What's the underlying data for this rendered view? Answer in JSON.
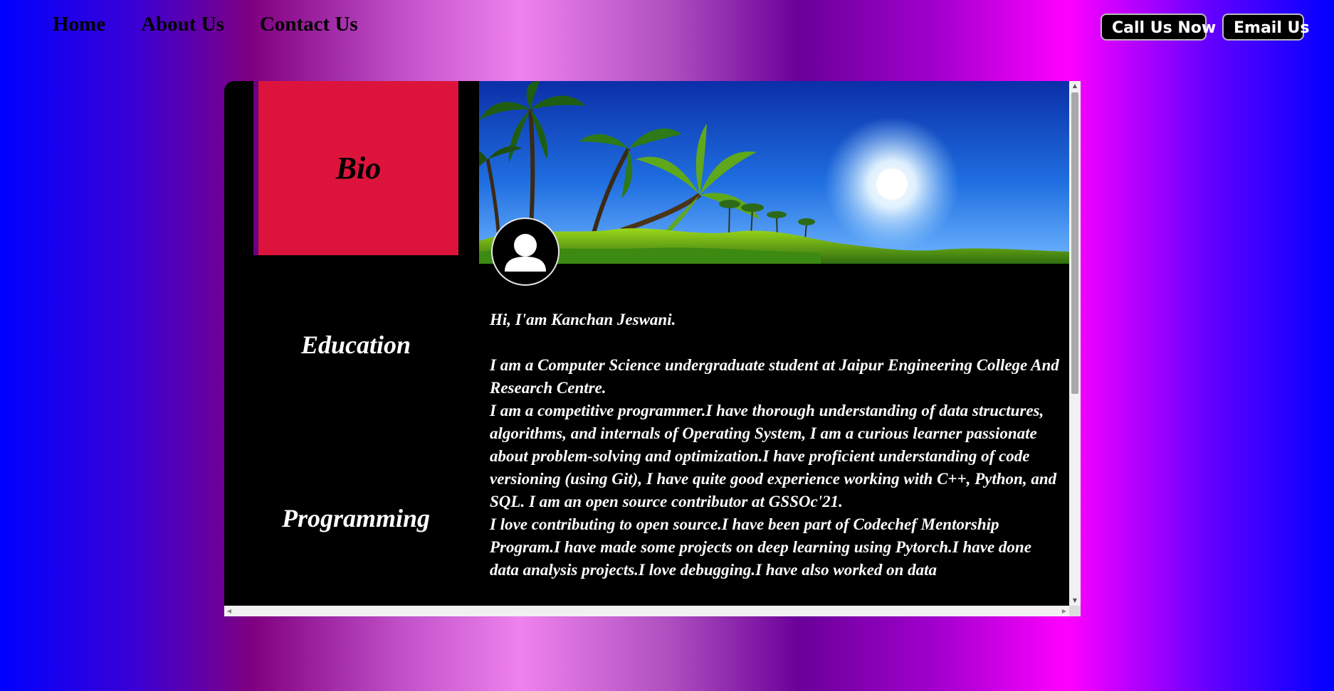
{
  "nav": {
    "home": "Home",
    "about": "About Us",
    "contact": "Contact Us"
  },
  "actions": {
    "call": "Call Us Now",
    "email": "Email Us"
  },
  "sidebar": {
    "bio": "Bio",
    "education": "Education",
    "programming": "Programming"
  },
  "profile": {
    "greeting": "Hi, I'am Kanchan Jeswani.",
    "para1": "I am a Computer Science undergraduate student at Jaipur Engineering College And Research Centre.",
    "para2": "I am a competitive programmer.I have thorough understanding of data structures, algorithms, and internals of Operating System, I am a curious learner passionate about problem-solving and optimization.I have proficient understanding of code versioning (using Git), I have quite good experience working with C++, Python, and SQL. I am an open source contributor at GSSOc'21.",
    "para3": "I love contributing to open source.I have been part of Codechef Mentorship Program.I have made some projects on deep learning using Pytorch.I have done data analysis projects.I love debugging.I have also worked on data"
  },
  "icons": {
    "avatar": "user-silhouette-icon",
    "cover": "tropical-beach-palms-image"
  },
  "colors": {
    "bio_tile": "#dc143c",
    "card_bg": "#000000",
    "text": "#ffffff"
  }
}
